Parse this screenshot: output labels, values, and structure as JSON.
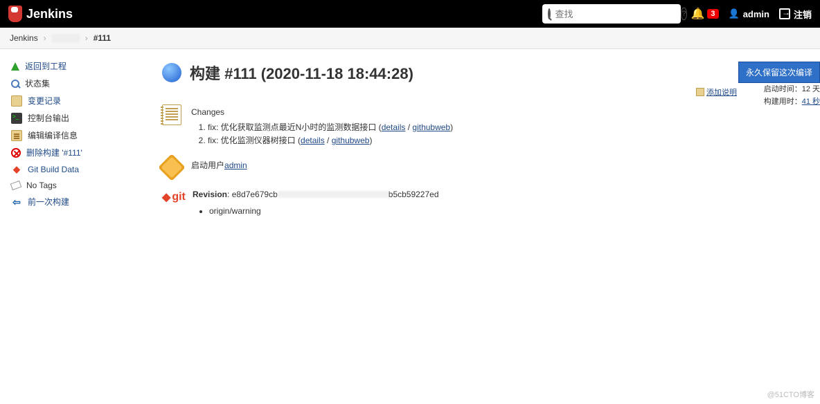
{
  "header": {
    "brand": "Jenkins",
    "search_placeholder": "查找",
    "notif_count": "3",
    "user": "admin",
    "logout": "注销"
  },
  "breadcrumb": {
    "root": "Jenkins",
    "current": "#111"
  },
  "sidebar": {
    "items": [
      {
        "label": "返回到工程"
      },
      {
        "label": "状态集"
      },
      {
        "label": "变更记录"
      },
      {
        "label": "控制台输出"
      },
      {
        "label": "编辑编译信息"
      },
      {
        "label": "删除构建 '#111'"
      },
      {
        "label": "Git Build Data"
      },
      {
        "label": "No Tags"
      },
      {
        "label": "前一次构建"
      }
    ]
  },
  "main": {
    "title": "构建 #111 (2020-11-18 18:44:28)",
    "keep_button": "永久保留这次编译",
    "add_description": "添加说明",
    "meta": {
      "started_label": "启动时间：",
      "started_value": "12 天",
      "duration_label": "构建用时：",
      "duration_link": "41 秒"
    },
    "changes": {
      "heading": "Changes",
      "items": [
        {
          "text": "fix: 优化获取监测点最近N小时的监测数据接口",
          "details": "details",
          "web": "githubweb"
        },
        {
          "text": "fix: 优化监测仪器树接口",
          "details": "details",
          "web": "githubweb"
        }
      ]
    },
    "started_by": {
      "label": "启动用户",
      "user": "admin"
    },
    "git": {
      "revision_label": "Revision",
      "revision_prefix": "e8d7e679cb",
      "revision_suffix": "b5cb59227ed",
      "branch": "origin/warning"
    }
  },
  "watermark": "@51CTO博客"
}
